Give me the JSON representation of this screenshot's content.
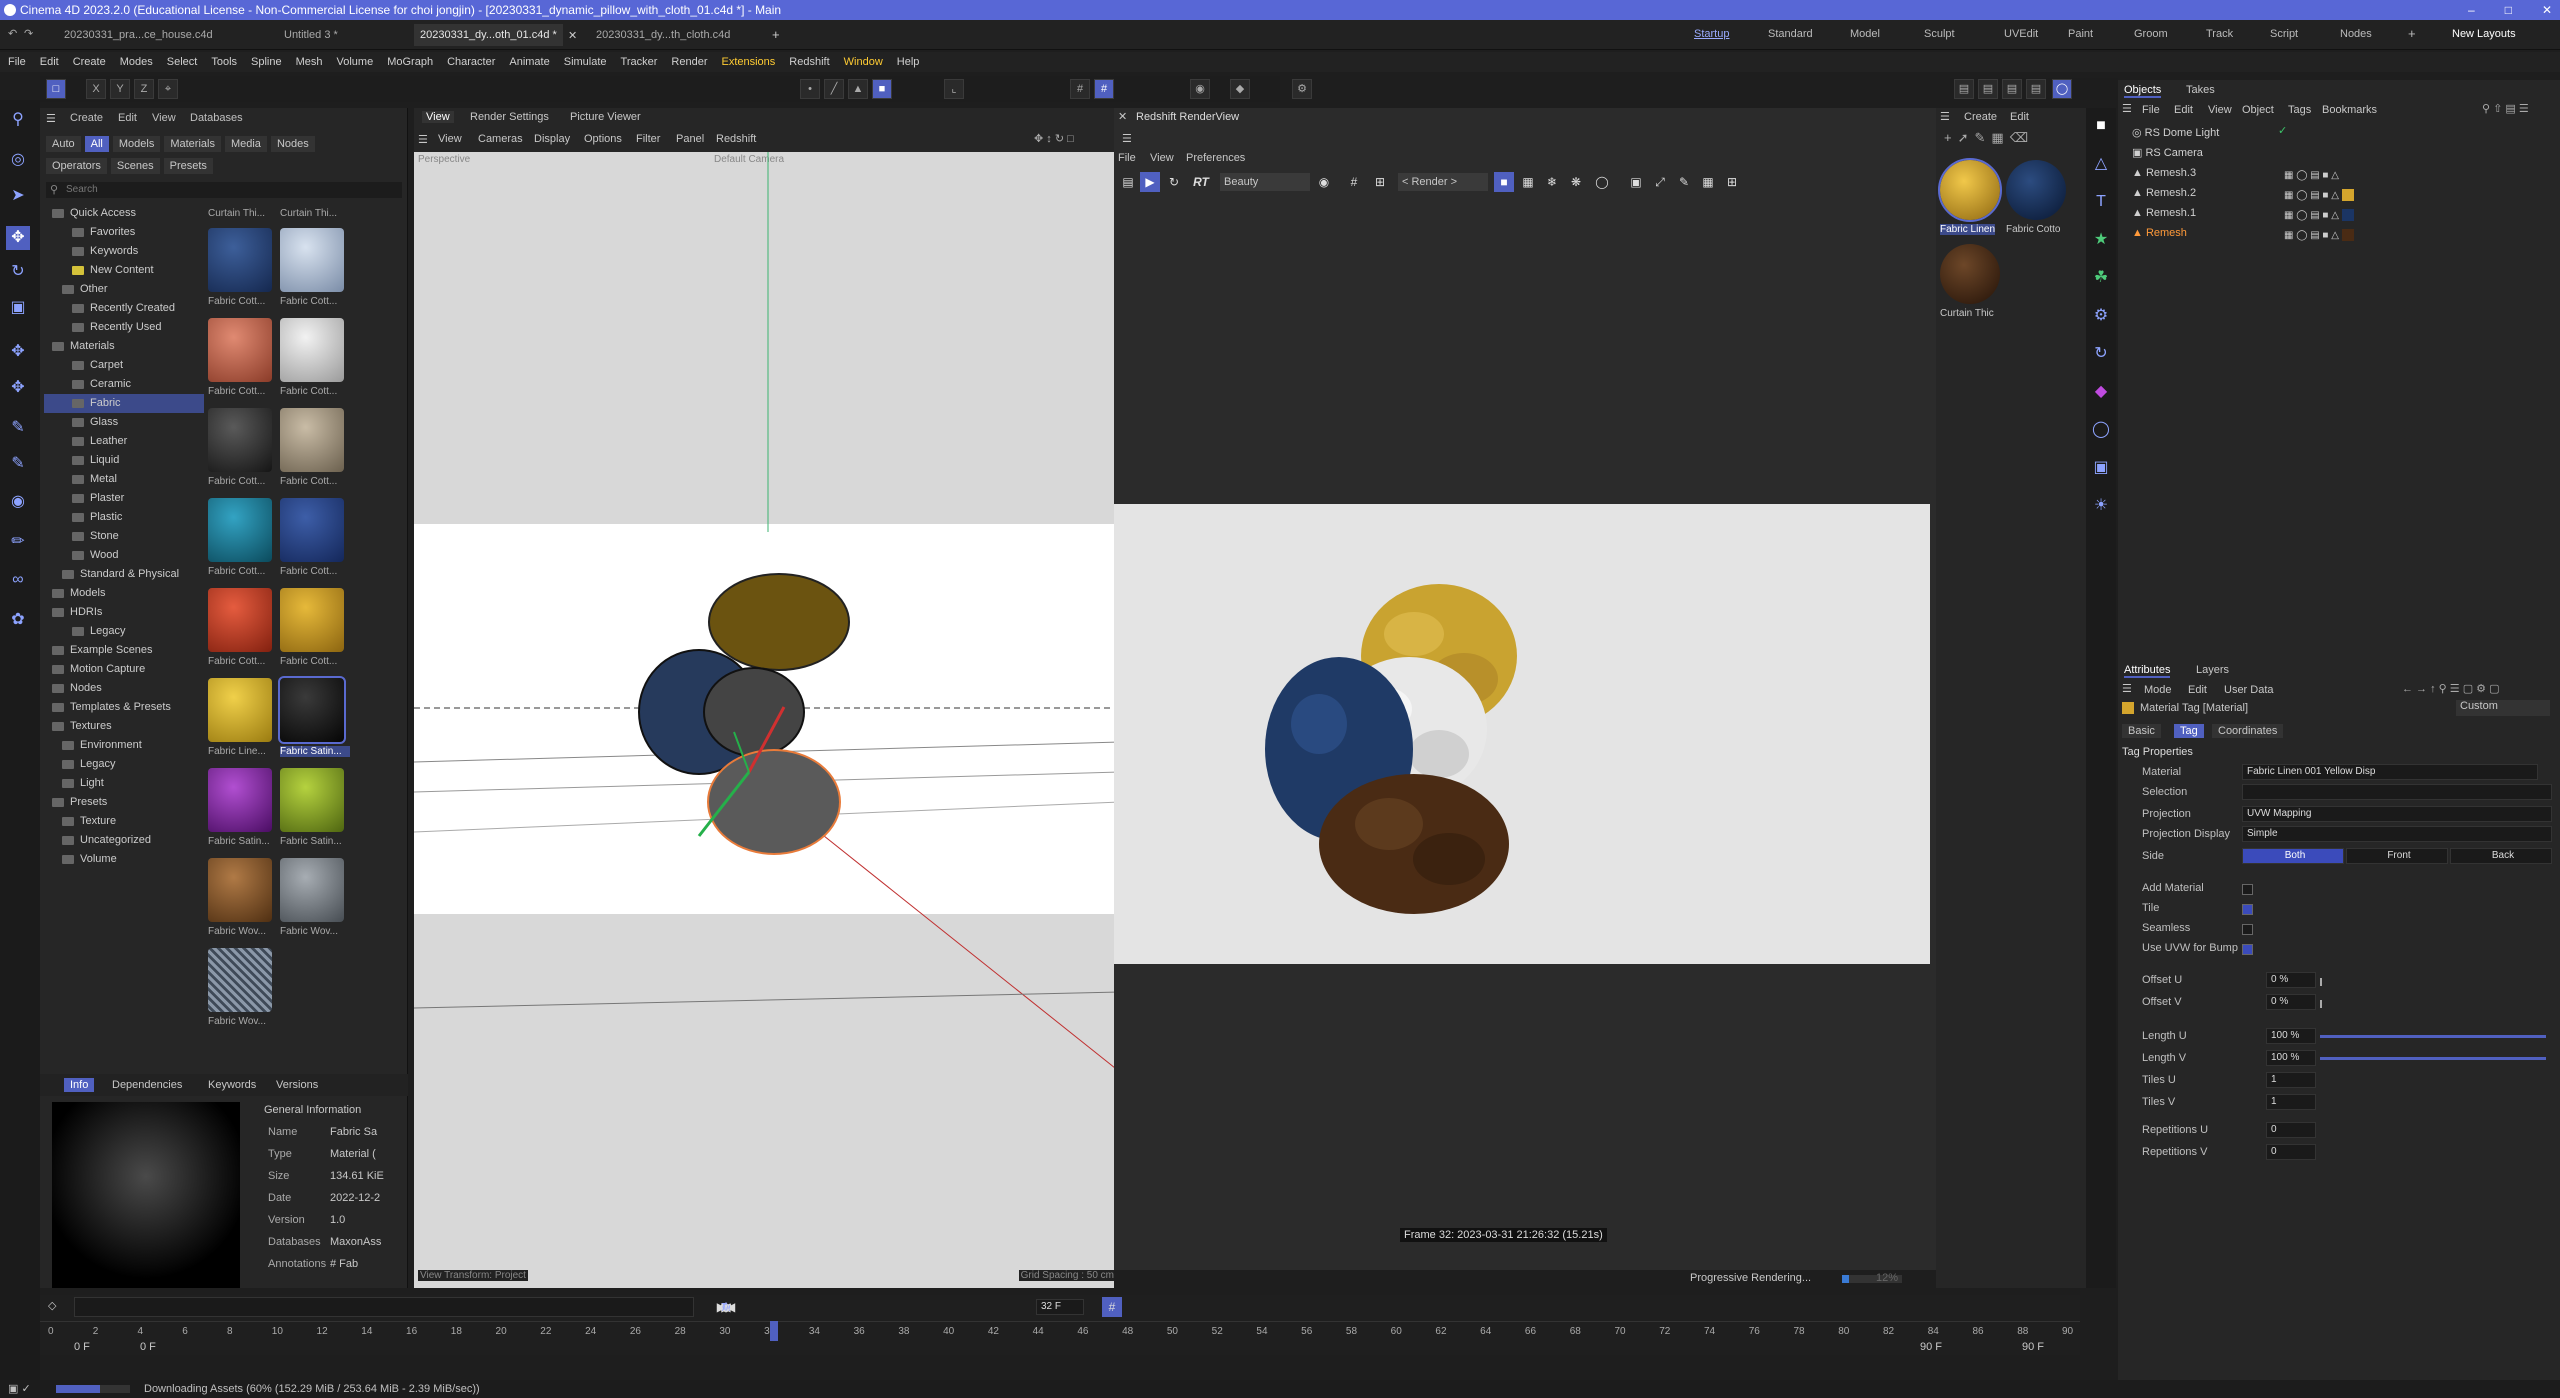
{
  "window": {
    "title": "Cinema 4D 2023.2.0 (Educational License - Non-Commercial License for choi jongjin) - [20230331_dynamic_pillow_with_cloth_01.c4d *] - Main"
  },
  "doc_tabs": [
    "20230331_pra...ce_house.c4d",
    "Untitled 3 *",
    "20230331_dy...oth_01.c4d *",
    "20230331_dy...th_cloth.c4d"
  ],
  "layouts": [
    "Startup",
    "Standard",
    "Model",
    "Sculpt",
    "UVEdit",
    "Paint",
    "Groom",
    "Track",
    "Script",
    "Nodes",
    "New Layouts"
  ],
  "menu": [
    "File",
    "Edit",
    "Create",
    "Modes",
    "Select",
    "Tools",
    "Spline",
    "Mesh",
    "Volume",
    "MoGraph",
    "Character",
    "Animate",
    "Simulate",
    "Tracker",
    "Render",
    "Extensions",
    "Redshift",
    "Window",
    "Help"
  ],
  "asset": {
    "menu": [
      "Create",
      "Edit",
      "View",
      "Databases"
    ],
    "filters": [
      "Auto",
      "All",
      "Models",
      "Materials",
      "Media",
      "Nodes"
    ],
    "subtabs": [
      "Operators",
      "Scenes",
      "Presets"
    ],
    "search_placeholder": "Search",
    "tree": [
      "Quick Access",
      "Favorites",
      "Keywords",
      "New Content",
      "Other",
      "Recently Created",
      "Recently Used",
      "Materials",
      "Carpet",
      "Ceramic",
      "Fabric",
      "Glass",
      "Leather",
      "Liquid",
      "Metal",
      "Plaster",
      "Plastic",
      "Stone",
      "Wood",
      "Standard & Physical",
      "Models",
      "HDRIs",
      "Legacy",
      "Example Scenes",
      "Motion Capture",
      "Nodes",
      "Templates & Presets",
      "Textures",
      "Environment",
      "Legacy",
      "Light",
      "Presets",
      "Texture",
      "Uncategorized",
      "Volume"
    ],
    "col_heads": [
      "Curtain Thi...",
      "Curtain Thi..."
    ],
    "thumbs": [
      "Fabric Cott...",
      "Fabric Cott...",
      "Fabric Cott...",
      "Fabric Cott...",
      "Fabric Cott...",
      "Fabric Cott...",
      "Fabric Cott...",
      "Fabric Cott...",
      "Fabric Cott...",
      "Fabric Cott...",
      "Fabric Line...",
      "Fabric Satin...",
      "Fabric Satin...",
      "Fabric Satin...",
      "Fabric Wov...",
      "Fabric Wov...",
      "Fabric Wov..."
    ],
    "info_tabs": [
      "Info",
      "Dependencies",
      "Keywords",
      "Versions"
    ],
    "general": "General Information",
    "info_rows": [
      [
        "Name",
        "Fabric Sa"
      ],
      [
        "Type",
        "Material ("
      ],
      [
        "Size",
        "134.61 KiE"
      ],
      [
        "Date",
        "2022-12-2"
      ],
      [
        "Version",
        "1.0"
      ],
      [
        "Databases",
        "MaxonAss"
      ],
      [
        "Annotations",
        "# Fab"
      ]
    ]
  },
  "viewport": {
    "tabs": [
      "View",
      "Render Settings",
      "Picture Viewer"
    ],
    "menu": [
      "View",
      "Cameras",
      "Display",
      "Options",
      "Filter",
      "Panel",
      "Redshift"
    ],
    "camera": "Perspective",
    "camera2": "Default Camera",
    "footer_left": "View Transform: Project",
    "footer_right": "Grid Spacing : 50 cm"
  },
  "renderview": {
    "title": "Redshift RenderView",
    "menu": [
      "File",
      "View",
      "Preferences"
    ],
    "aov": "Beauty",
    "render_btn": "< Render >",
    "frame_info": "Frame  32:  2023-03-31  21:26:32  (15.21s)",
    "progress_text": "Progressive Rendering...",
    "progress_pct": "12%",
    "progress_value": 0.12
  },
  "materials": {
    "menu": [
      "Create",
      "Edit"
    ],
    "items": [
      "Fabric Linen",
      "Fabric Cotto",
      "Curtain Thic"
    ]
  },
  "objects": {
    "tabs": [
      "Objects",
      "Takes"
    ],
    "menu": [
      "File",
      "Edit",
      "View",
      "Object",
      "Tags",
      "Bookmarks"
    ],
    "items": [
      "RS Dome Light",
      "RS Camera",
      "Remesh.3",
      "Remesh.2",
      "Remesh.1",
      "Remesh"
    ]
  },
  "attributes": {
    "tabs": [
      "Attributes",
      "Layers"
    ],
    "menu": [
      "Mode",
      "Edit",
      "User Data"
    ],
    "preset": "Custom",
    "header": "Material Tag [Material]",
    "subtabs": [
      "Basic",
      "Tag",
      "Coordinates"
    ],
    "section": "Tag Properties",
    "material_label": "Material",
    "material_value": "Fabric Linen 001 Yellow Disp",
    "selection_label": "Selection",
    "projection_label": "Projection",
    "projection_value": "UVW Mapping",
    "projdisp_label": "Projection Display",
    "projdisp_value": "Simple",
    "side_label": "Side",
    "side_opts": [
      "Both",
      "Front",
      "Back"
    ],
    "checks": [
      "Add Material",
      "Tile",
      "Seamless",
      "Use UVW for Bump"
    ],
    "offsetu_label": "Offset U",
    "offsetu": "0 %",
    "offsetv_label": "Offset V",
    "offsetv": "0 %",
    "lengthu_label": "Length U",
    "lengthu": "100 %",
    "lengthv_label": "Length V",
    "lengthv": "100 %",
    "tilesu_label": "Tiles U",
    "tilesu": "1",
    "tilesv_label": "Tiles V",
    "tilesv": "1",
    "repu_label": "Repetitions U",
    "repu": "0",
    "repv_label": "Repetitions V",
    "repv": "0"
  },
  "timeline": {
    "frame": "32 F",
    "ticks": [
      "0",
      "2",
      "4",
      "6",
      "8",
      "10",
      "12",
      "14",
      "16",
      "18",
      "20",
      "22",
      "24",
      "26",
      "28",
      "30",
      "32",
      "34",
      "36",
      "38",
      "40",
      "42",
      "44",
      "46",
      "48",
      "50",
      "52",
      "54",
      "56",
      "58",
      "60",
      "62",
      "64",
      "66",
      "68",
      "70",
      "72",
      "74",
      "76",
      "78",
      "80",
      "82",
      "84",
      "86",
      "88",
      "90"
    ],
    "start": "0 F",
    "start2": "0 F",
    "end": "90 F",
    "end2": "90 F"
  },
  "status": "Downloading Assets (60% (152.29 MiB / 253.64 MiB - 2.39 MiB/sec))"
}
